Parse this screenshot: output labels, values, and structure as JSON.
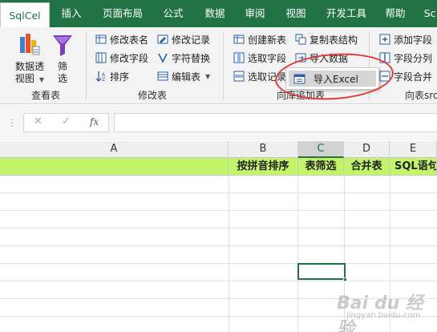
{
  "tabs": [
    {
      "label": "SqlCel",
      "active": true
    },
    {
      "label": "插入"
    },
    {
      "label": "页面布局"
    },
    {
      "label": "公式"
    },
    {
      "label": "数据"
    },
    {
      "label": "审阅"
    },
    {
      "label": "视图"
    },
    {
      "label": "开发工具"
    },
    {
      "label": "帮助"
    },
    {
      "label": "Sc"
    }
  ],
  "ribbon": {
    "query_group": {
      "label": "查看表",
      "pivot_line1": "数据透",
      "pivot_line2": "视图",
      "filter_line1": "筛",
      "filter_line2": "选"
    },
    "modify_group": {
      "label": "修改表",
      "rename_table": "修改表名",
      "modify_record": "修改记录",
      "modify_field": "修改字段",
      "replace_char": "字符替换",
      "sort": "排序",
      "edit_table": "编辑表"
    },
    "db_group": {
      "label": "向库追加表",
      "create_table": "创建新表",
      "copy_structure": "复制表结构",
      "select_field": "选取字段",
      "import_data": "导入数据",
      "select_record": "选取记录"
    },
    "field_group": {
      "label": "向表src",
      "add_field": "添加字段",
      "split_field": "字段分列",
      "merge_field": "字段合并"
    }
  },
  "popup": {
    "item": "导入Excel"
  },
  "formula_bar": {
    "fx": "fx",
    "cancel": "✕",
    "confirm": "✓",
    "value": ""
  },
  "columns": [
    "A",
    "B",
    "C",
    "D",
    "E"
  ],
  "row1": [
    "",
    "按拼音排序",
    "表筛选",
    "合并表",
    "SQL语句"
  ],
  "colors": {
    "excel_green": "#217346",
    "row1_bg": "#c3f56a",
    "highlight_ring": "#e23a3a"
  },
  "watermark": {
    "main": "Bai du 经验",
    "sub": "jingyan.baidu.com"
  }
}
